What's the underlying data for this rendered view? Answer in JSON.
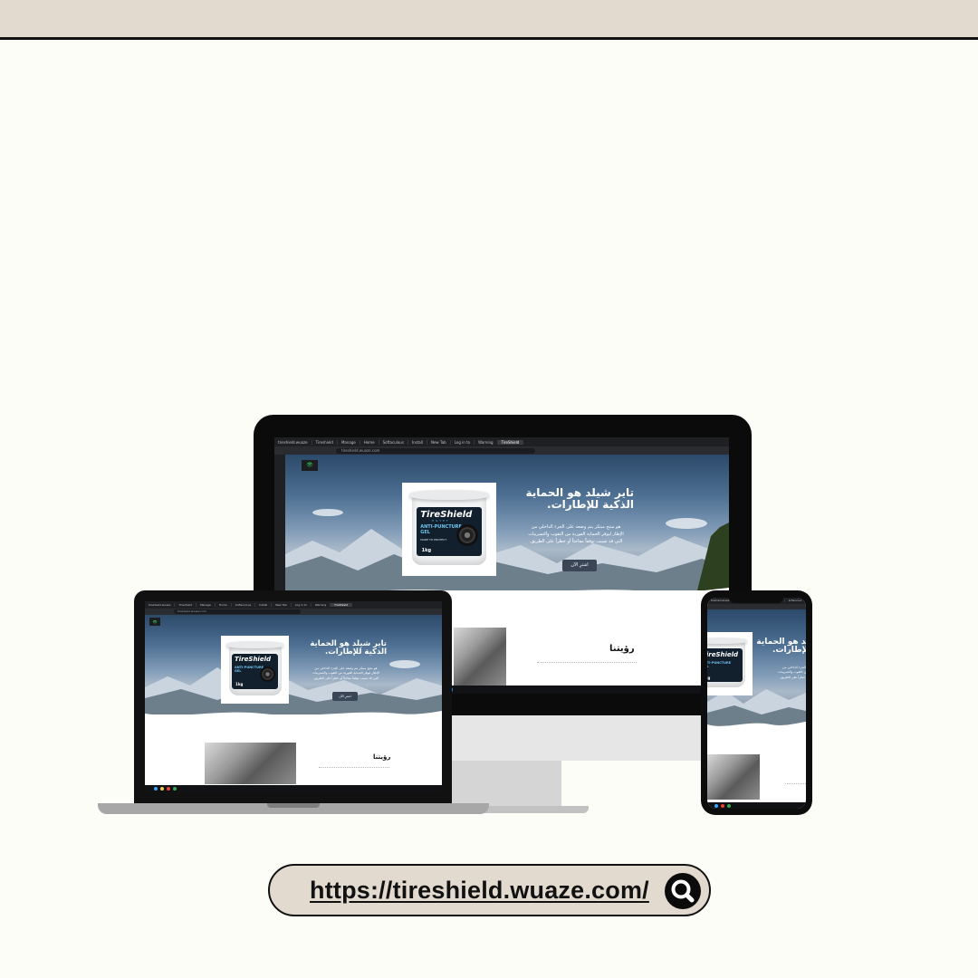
{
  "link": {
    "url": "https://tireshield.wuaze.com/"
  },
  "browser": {
    "tabs_desktop": [
      "tireshield.wuaze",
      "Tireshield",
      "Manage",
      "Home",
      "Softaculous",
      "Install",
      "New Tab",
      "Log in to",
      "Warning",
      "TireShield"
    ],
    "url": "tireshield.wuaze.com"
  },
  "site": {
    "badge": "👁",
    "hero_title_line1": "تاير شيلد هو الحماية",
    "hero_title_line2": "الذكية للإطارات.",
    "hero_desc_line1": "هو منتج مبتكر يتم وضعه على الجزء الداخلي من",
    "hero_desc_line2": "الإطار ليوفر الحماية الفورية من الثقوب والتسريبات",
    "hero_desc_line3": "التي قد تسبب توقفاً مفاجئاً أو خطراً على الطريق.",
    "buy_button": "اشترِ الآن",
    "vision_title": "رؤيتنا"
  },
  "product": {
    "brand": "TireShield",
    "region": "EGYPT",
    "name_line1": "ANTI-PUNCTURE",
    "name_line2": "GEL",
    "tagline": "MADE TO PROTECT",
    "weight": "1kg"
  },
  "colors": {
    "accent_band": "#e2d9cf",
    "background": "#fdfdf8",
    "button": "#3a4656"
  }
}
